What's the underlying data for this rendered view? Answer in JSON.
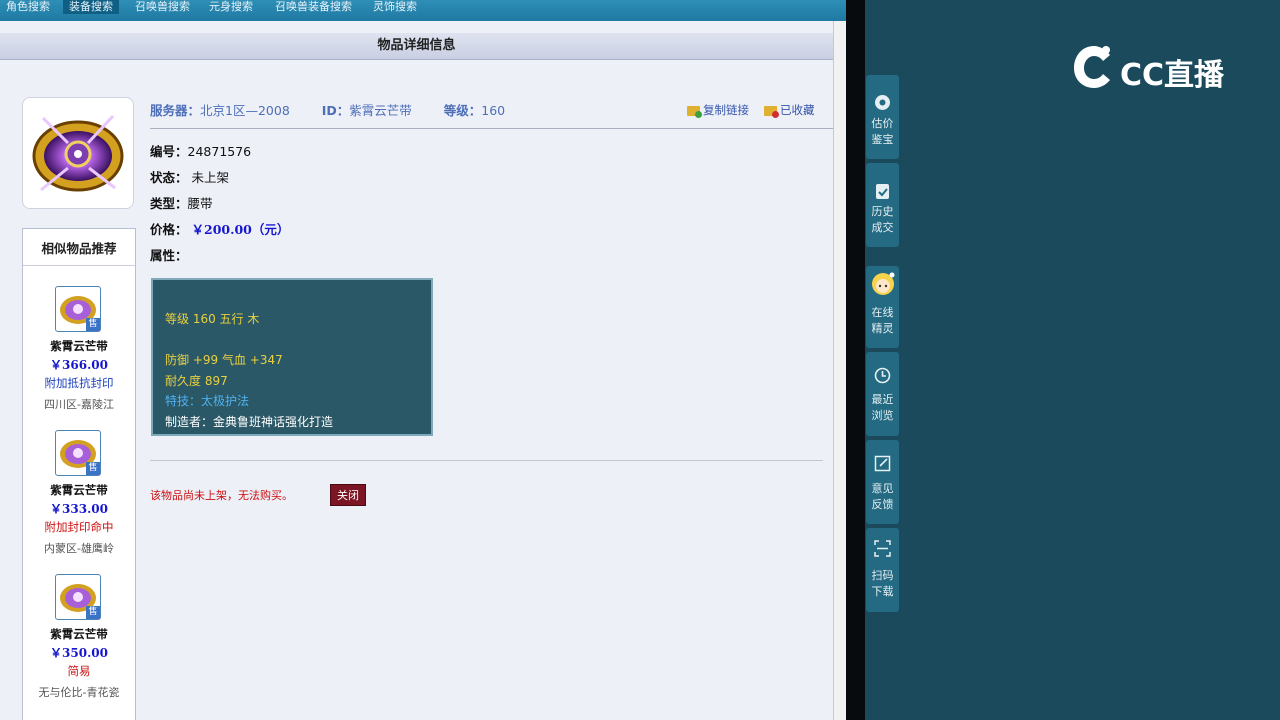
{
  "top_nav": [
    "角色搜索",
    "装备搜索",
    "召唤兽搜索",
    "元身搜索",
    "召唤兽装备搜索",
    "灵饰搜索"
  ],
  "active_tab_index": 1,
  "page_header": "物品详细信息",
  "item": {
    "server_label": "服务器：",
    "server": "北京1区—2008",
    "id_label": "ID：",
    "id": "紫霄云芒带",
    "level_label": "等级：",
    "level": "160",
    "copy_link": "复制链接",
    "favorited": "已收藏",
    "number_label": "编号：",
    "number": "24871576",
    "status_label": "状态：",
    "status": "未上架",
    "type_label": "类型：",
    "type": "腰带",
    "price_label": "价格：",
    "price": "￥200.00（元）",
    "attr_label": "属性："
  },
  "attributes": {
    "line1": "等级 160  五行 木",
    "line2": "防御 +99  气血 +347",
    "line3": "耐久度 897",
    "line4": "特技：太极护法",
    "line5": "制造者：金典鲁班神话强化打造"
  },
  "notice": "该物品尚未上架，无法购买。",
  "close_label": "关闭",
  "similar": {
    "title": "相似物品推荐",
    "sell_badge": "售",
    "items": [
      {
        "name": "紫霄云芒带",
        "price": "￥366.00",
        "attr": "附加抵抗封印",
        "attr_color": "#1a3ec0",
        "server": "四川区-嘉陵江"
      },
      {
        "name": "紫霄云芒带",
        "price": "￥333.00",
        "attr": "附加封印命中",
        "attr_color": "#cc1010",
        "server": "内蒙区-雄鹰岭"
      },
      {
        "name": "紫霄云芒带",
        "price": "￥350.00",
        "attr": "简易",
        "attr_color": "#cc1010",
        "server": "无与伦比-青花瓷"
      }
    ]
  },
  "stream": {
    "logo": "CC直播",
    "side_buttons": [
      {
        "label1": "估价",
        "label2": "鉴宝",
        "icon": "appraise-icon"
      },
      {
        "label1": "历史",
        "label2": "成交",
        "icon": "history-icon"
      },
      {
        "label1": "在线",
        "label2": "精灵",
        "icon": "sprite-avatar-icon"
      },
      {
        "label1": "最近",
        "label2": "浏览",
        "icon": "clock-icon"
      },
      {
        "label1": "意见",
        "label2": "反馈",
        "icon": "edit-icon"
      },
      {
        "label1": "扫码",
        "label2": "下载",
        "icon": "scan-icon"
      }
    ]
  }
}
